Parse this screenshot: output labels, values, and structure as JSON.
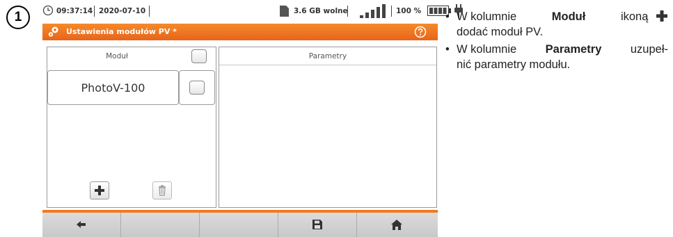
{
  "step": {
    "number": "1"
  },
  "status_bar": {
    "time": "09:37:14",
    "date": "2020-07-10",
    "storage_free": "3.6 GB wolne",
    "battery_percent": "100 %",
    "icons": [
      "clock-icon",
      "sd-card-icon",
      "signal-strength-icon",
      "battery-icon",
      "power-plug-icon"
    ]
  },
  "title_bar": {
    "title": "Ustawienia modułów PV *",
    "icons": [
      "gears-icon",
      "help-icon"
    ]
  },
  "module_panel": {
    "header": "Moduł",
    "items": [
      {
        "name": "PhotoV-100",
        "checked": false
      }
    ],
    "header_checked": false,
    "buttons": [
      "add-icon",
      "trash-icon"
    ]
  },
  "params_panel": {
    "header": "Parametry"
  },
  "bottom_nav": {
    "buttons": [
      "back-arrow-icon",
      "",
      "",
      "save-icon",
      "home-icon"
    ]
  },
  "instructions": {
    "item1": {
      "prefix": "W kolumnie",
      "bold": "Moduł",
      "middle": "ikoną",
      "line2": "dodać moduł PV."
    },
    "item2": {
      "prefix": "W kolumnie",
      "bold": "Parametry",
      "suffix": "uzupeł-",
      "line2": "nić parametry modułu."
    }
  },
  "colors": {
    "accent_orange": "#f07a22",
    "panel_border": "#9a9a9a",
    "bottom_bar": "#d0d0d0"
  }
}
